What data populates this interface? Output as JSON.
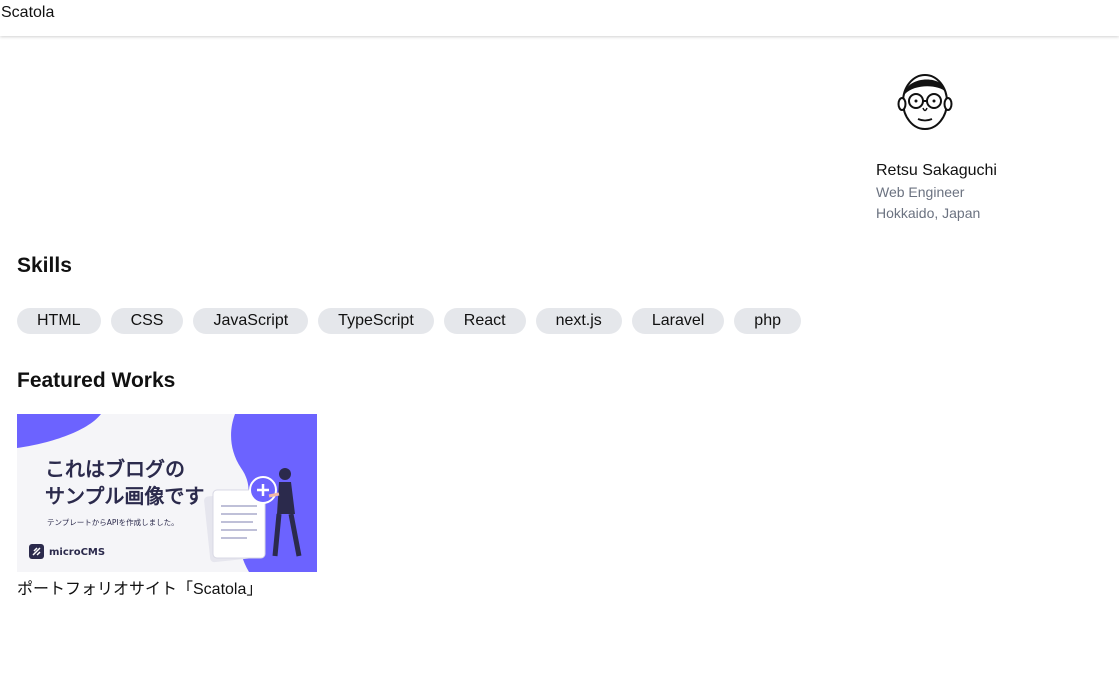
{
  "header": {
    "brand": "Scatola"
  },
  "profile": {
    "name": "Retsu Sakaguchi",
    "role": "Web Engineer",
    "location": "Hokkaido, Japan"
  },
  "skills": {
    "title": "Skills",
    "items": [
      "HTML",
      "CSS",
      "JavaScript",
      "TypeScript",
      "React",
      "next.js",
      "Laravel",
      "php"
    ]
  },
  "works": {
    "title": "Featured Works",
    "items": [
      {
        "title": "ポートフォリオサイト「Scatola」",
        "image_line1": "これはブログの",
        "image_line2": "サンプル画像です",
        "image_caption": "テンプレートからAPIを作成しました。",
        "image_brand": "microCMS"
      }
    ]
  },
  "colors": {
    "accent": "#6c63ff",
    "chip_bg": "#e5e7eb",
    "muted_text": "#6b7280",
    "thumb_text": "#2b2a4c"
  }
}
